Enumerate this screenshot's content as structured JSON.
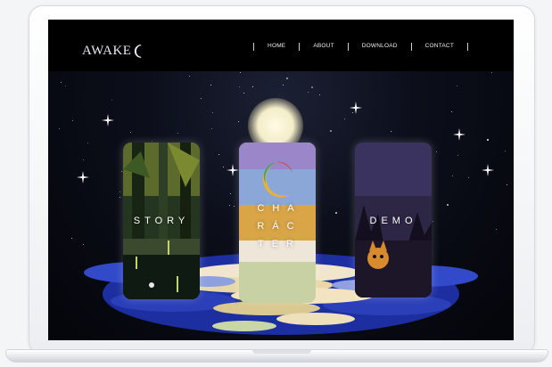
{
  "site": {
    "logo_text": "AWAKE"
  },
  "nav": {
    "items": [
      {
        "label": "HOME"
      },
      {
        "label": "ABOUT"
      },
      {
        "label": "DOWNLOAD"
      },
      {
        "label": "CONTACT"
      }
    ]
  },
  "cards": {
    "story": {
      "label": "STORY"
    },
    "character": {
      "lines": [
        "CHA",
        "RÁC",
        "TER"
      ]
    },
    "demo": {
      "label": "DEMO"
    }
  },
  "colors": {
    "header_bg": "#000000",
    "sky": "#0c0f1b",
    "moon": "#f4edc8",
    "water": "#2b3fb8"
  }
}
